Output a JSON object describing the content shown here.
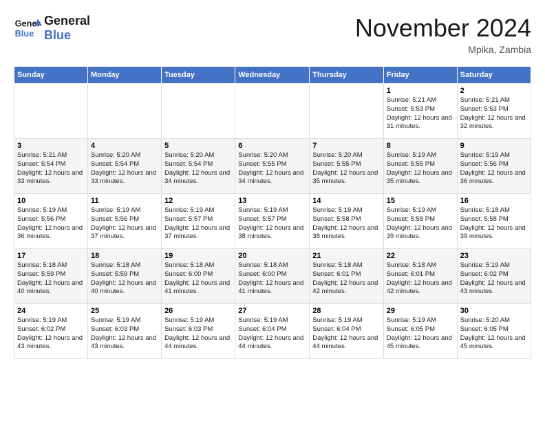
{
  "header": {
    "logo_line1": "General",
    "logo_line2": "Blue",
    "month_year": "November 2024",
    "location": "Mpika, Zambia"
  },
  "days_of_week": [
    "Sunday",
    "Monday",
    "Tuesday",
    "Wednesday",
    "Thursday",
    "Friday",
    "Saturday"
  ],
  "weeks": [
    [
      {
        "day": "",
        "info": ""
      },
      {
        "day": "",
        "info": ""
      },
      {
        "day": "",
        "info": ""
      },
      {
        "day": "",
        "info": ""
      },
      {
        "day": "",
        "info": ""
      },
      {
        "day": "1",
        "info": "Sunrise: 5:21 AM\nSunset: 5:53 PM\nDaylight: 12 hours and 31 minutes."
      },
      {
        "day": "2",
        "info": "Sunrise: 5:21 AM\nSunset: 5:53 PM\nDaylight: 12 hours and 32 minutes."
      }
    ],
    [
      {
        "day": "3",
        "info": "Sunrise: 5:21 AM\nSunset: 5:54 PM\nDaylight: 12 hours and 33 minutes."
      },
      {
        "day": "4",
        "info": "Sunrise: 5:20 AM\nSunset: 5:54 PM\nDaylight: 12 hours and 33 minutes."
      },
      {
        "day": "5",
        "info": "Sunrise: 5:20 AM\nSunset: 5:54 PM\nDaylight: 12 hours and 34 minutes."
      },
      {
        "day": "6",
        "info": "Sunrise: 5:20 AM\nSunset: 5:55 PM\nDaylight: 12 hours and 34 minutes."
      },
      {
        "day": "7",
        "info": "Sunrise: 5:20 AM\nSunset: 5:55 PM\nDaylight: 12 hours and 35 minutes."
      },
      {
        "day": "8",
        "info": "Sunrise: 5:19 AM\nSunset: 5:55 PM\nDaylight: 12 hours and 35 minutes."
      },
      {
        "day": "9",
        "info": "Sunrise: 5:19 AM\nSunset: 5:56 PM\nDaylight: 12 hours and 36 minutes."
      }
    ],
    [
      {
        "day": "10",
        "info": "Sunrise: 5:19 AM\nSunset: 5:56 PM\nDaylight: 12 hours and 36 minutes."
      },
      {
        "day": "11",
        "info": "Sunrise: 5:19 AM\nSunset: 5:56 PM\nDaylight: 12 hours and 37 minutes."
      },
      {
        "day": "12",
        "info": "Sunrise: 5:19 AM\nSunset: 5:57 PM\nDaylight: 12 hours and 37 minutes."
      },
      {
        "day": "13",
        "info": "Sunrise: 5:19 AM\nSunset: 5:57 PM\nDaylight: 12 hours and 38 minutes."
      },
      {
        "day": "14",
        "info": "Sunrise: 5:19 AM\nSunset: 5:58 PM\nDaylight: 12 hours and 38 minutes."
      },
      {
        "day": "15",
        "info": "Sunrise: 5:19 AM\nSunset: 5:58 PM\nDaylight: 12 hours and 39 minutes."
      },
      {
        "day": "16",
        "info": "Sunrise: 5:18 AM\nSunset: 5:58 PM\nDaylight: 12 hours and 39 minutes."
      }
    ],
    [
      {
        "day": "17",
        "info": "Sunrise: 5:18 AM\nSunset: 5:59 PM\nDaylight: 12 hours and 40 minutes."
      },
      {
        "day": "18",
        "info": "Sunrise: 5:18 AM\nSunset: 5:59 PM\nDaylight: 12 hours and 40 minutes."
      },
      {
        "day": "19",
        "info": "Sunrise: 5:18 AM\nSunset: 6:00 PM\nDaylight: 12 hours and 41 minutes."
      },
      {
        "day": "20",
        "info": "Sunrise: 5:18 AM\nSunset: 6:00 PM\nDaylight: 12 hours and 41 minutes."
      },
      {
        "day": "21",
        "info": "Sunrise: 5:18 AM\nSunset: 6:01 PM\nDaylight: 12 hours and 42 minutes."
      },
      {
        "day": "22",
        "info": "Sunrise: 5:18 AM\nSunset: 6:01 PM\nDaylight: 12 hours and 42 minutes."
      },
      {
        "day": "23",
        "info": "Sunrise: 5:19 AM\nSunset: 6:02 PM\nDaylight: 12 hours and 43 minutes."
      }
    ],
    [
      {
        "day": "24",
        "info": "Sunrise: 5:19 AM\nSunset: 6:02 PM\nDaylight: 12 hours and 43 minutes."
      },
      {
        "day": "25",
        "info": "Sunrise: 5:19 AM\nSunset: 6:03 PM\nDaylight: 12 hours and 43 minutes."
      },
      {
        "day": "26",
        "info": "Sunrise: 5:19 AM\nSunset: 6:03 PM\nDaylight: 12 hours and 44 minutes."
      },
      {
        "day": "27",
        "info": "Sunrise: 5:19 AM\nSunset: 6:04 PM\nDaylight: 12 hours and 44 minutes."
      },
      {
        "day": "28",
        "info": "Sunrise: 5:19 AM\nSunset: 6:04 PM\nDaylight: 12 hours and 44 minutes."
      },
      {
        "day": "29",
        "info": "Sunrise: 5:19 AM\nSunset: 6:05 PM\nDaylight: 12 hours and 45 minutes."
      },
      {
        "day": "30",
        "info": "Sunrise: 5:20 AM\nSunset: 6:05 PM\nDaylight: 12 hours and 45 minutes."
      }
    ]
  ]
}
